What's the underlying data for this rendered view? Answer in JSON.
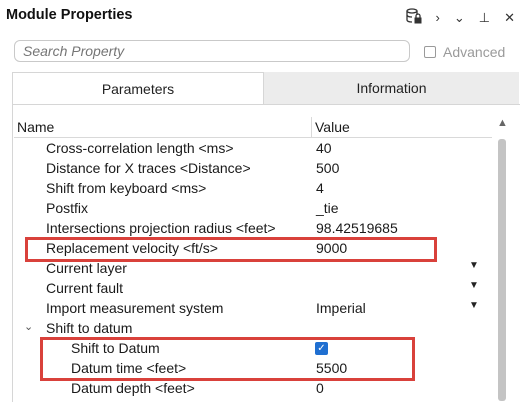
{
  "header": {
    "title": "Module Properties",
    "icons": [
      "database-lock-icon",
      "chevron-right-icon",
      "chevron-down-icon",
      "pin-icon",
      "close-icon"
    ],
    "glyphs": {
      "chevron_right": "›",
      "chevron_down": "⌄",
      "pin": "⊥",
      "close": "✕"
    }
  },
  "search": {
    "placeholder": "Search Property",
    "value": ""
  },
  "advanced": {
    "label": "Advanced",
    "checked": false
  },
  "tabs": [
    {
      "label": "Parameters",
      "active": true
    },
    {
      "label": "Information",
      "active": false
    }
  ],
  "table": {
    "columns": [
      "Name",
      "Value"
    ],
    "rows": [
      {
        "name": "Cross-correlation length <ms>",
        "value": "40"
      },
      {
        "name": "Distance for X traces <Distance>",
        "value": "500"
      },
      {
        "name": "Shift from keyboard <ms>",
        "value": "4"
      },
      {
        "name": "Postfix",
        "value": "_tie"
      },
      {
        "name": "Intersections projection radius <feet>",
        "value": "98.42519685"
      },
      {
        "name": "Replacement velocity <ft/s>",
        "value": "9000",
        "highlighted": true
      },
      {
        "name": "Current layer",
        "value": "",
        "dropdown": true
      },
      {
        "name": "Current fault",
        "value": "",
        "dropdown": true
      },
      {
        "name": "Import measurement system",
        "value": "Imperial",
        "dropdown": true
      },
      {
        "name": "Shift to datum",
        "group": true,
        "expanded": true
      },
      {
        "name": "Shift to Datum",
        "value": "",
        "checkbox": true,
        "checked": true,
        "child": true,
        "highlighted": true
      },
      {
        "name": "Datum time <feet>",
        "value": "5500",
        "child": true,
        "highlighted": true
      },
      {
        "name": "Datum depth <feet>",
        "value": "0",
        "child": true
      }
    ]
  },
  "colors": {
    "highlight": "#d9413b",
    "checkbox": "#1f6fd1"
  }
}
